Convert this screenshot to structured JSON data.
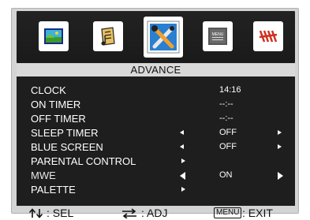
{
  "menu": {
    "title": "ADVANCE",
    "tabs": [
      {
        "name": "picture-icon"
      },
      {
        "name": "audio-icon"
      },
      {
        "name": "tools-icon",
        "selected": true
      },
      {
        "name": "menu-icon",
        "label": "MENU"
      },
      {
        "name": "antenna-icon"
      }
    ],
    "items": [
      {
        "label": "CLOCK",
        "value": "14:16"
      },
      {
        "label": "ON TIMER",
        "value": "--:--"
      },
      {
        "label": "OFF TIMER",
        "value": "--:--"
      },
      {
        "label": "SLEEP TIMER",
        "value": "OFF"
      },
      {
        "label": "BLUE SCREEN",
        "value": "OFF"
      },
      {
        "label": "PARENTAL CONTROL",
        "value": ""
      },
      {
        "label": "MWE",
        "value": "ON"
      },
      {
        "label": "PALETTE",
        "value": ""
      }
    ]
  },
  "footer": {
    "sel_label": ": SEL",
    "adj_label": ": ADJ",
    "menu_key": "MENU",
    "exit_label": ": EXIT"
  },
  "colors": {
    "panel_bg": "#1e1e1e",
    "frame_bg": "#d4d4d4",
    "icon_bar_bg": "#1a1a1a"
  }
}
